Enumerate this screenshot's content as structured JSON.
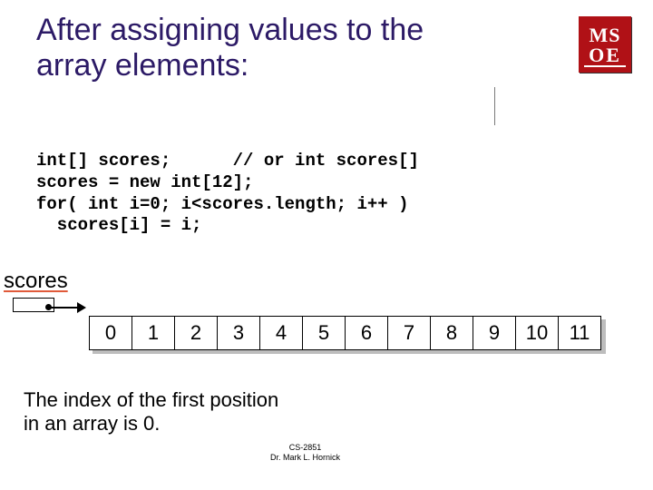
{
  "title": "After assigning values to the array elements:",
  "logo": {
    "top": "MS",
    "bottom": "OE"
  },
  "code": "int[] scores;      // or int scores[]\nscores = new int[12];\nfor( int i=0; i<scores.length; i++ )\n  scores[i] = i;",
  "scores_label": "scores",
  "array_values": [
    "0",
    "1",
    "2",
    "3",
    "4",
    "5",
    "6",
    "7",
    "8",
    "9",
    "10",
    "11"
  ],
  "caption": "The index of the first position in an array is 0.",
  "footer": {
    "course": "CS-2851",
    "author": "Dr. Mark L. Hornick"
  }
}
